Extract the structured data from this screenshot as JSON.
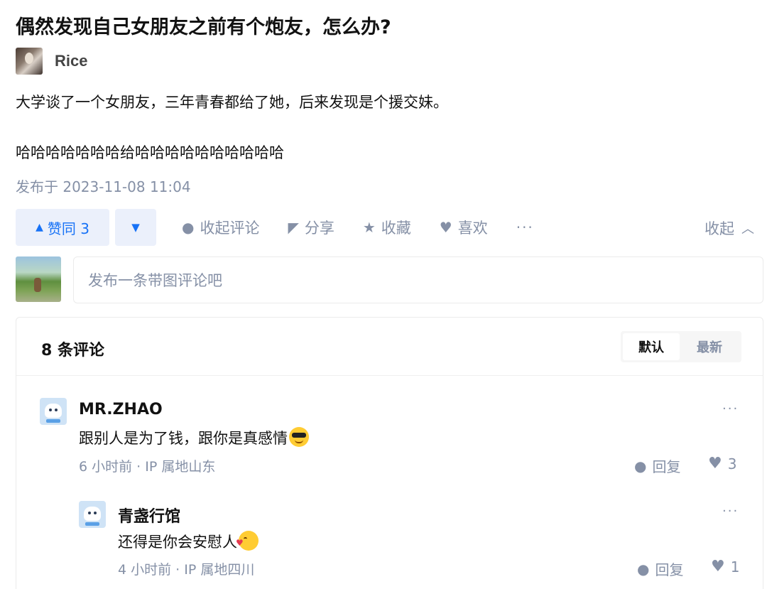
{
  "question": {
    "title": "偶然发现自己女朋友之前有个炮友，怎么办?"
  },
  "answer": {
    "author_name": "Rice",
    "paragraphs": [
      "大学谈了一个女朋友，三年青春都给了她，后来发现是个援交妹。",
      "哈哈哈哈哈哈哈给哈哈哈哈哈哈哈哈哈哈"
    ],
    "published": "发布于 2023-11-08 11:04"
  },
  "actions": {
    "vote_up_label": "赞同 3",
    "vote_up_arrow": "▲",
    "vote_down_arrow": "▼",
    "collapse_comments": "收起评论",
    "share": "分享",
    "favorite": "收藏",
    "like": "喜欢",
    "more": "···",
    "collapse": "收起"
  },
  "comment_input": {
    "placeholder": "发布一条带图评论吧"
  },
  "comments": {
    "count_label": "8 条评论",
    "sort_default": "默认",
    "sort_newest": "最新",
    "items": [
      {
        "name": "MR.ZHAO",
        "text": "跟别人是为了钱，跟你是真感情",
        "emoji": "sunglasses",
        "time": "6 小时前",
        "ip": "IP 属地山东",
        "reply_label": "回复",
        "likes": "3"
      },
      {
        "name": "青盏行馆",
        "text": "还得是你会安慰人",
        "emoji": "kissing-heart",
        "time": "4 小时前",
        "ip": "IP 属地四川",
        "reply_label": "回复",
        "likes": "1"
      }
    ]
  },
  "colors": {
    "accent": "#1772f6",
    "accent_bg": "#ebf0fb",
    "muted": "#8590a6",
    "text": "#121212"
  }
}
